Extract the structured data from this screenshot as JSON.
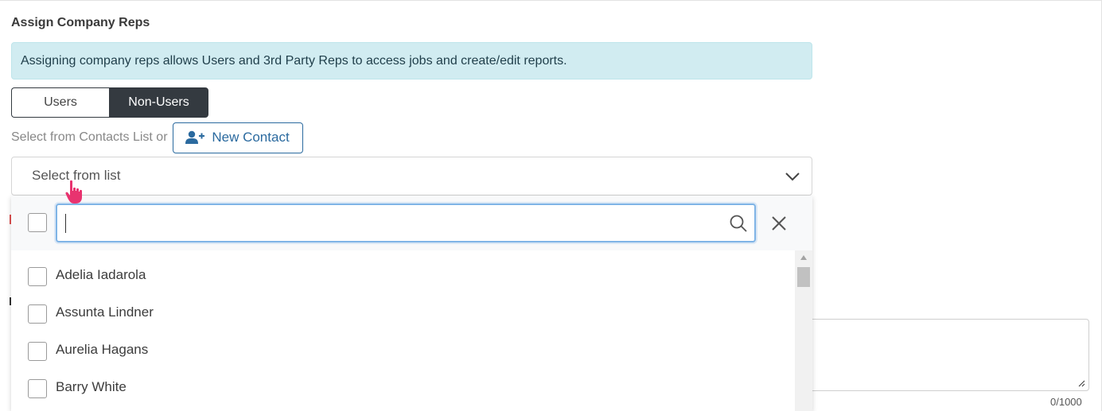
{
  "section": {
    "title": "Assign Company Reps"
  },
  "info_alert": {
    "text": "Assigning company reps allows Users and 3rd Party Reps to access jobs and create/edit reports."
  },
  "toggle": {
    "users_label": "Users",
    "non_users_label": "Non-Users",
    "active": "Non-Users"
  },
  "contacts": {
    "prompt": "Select from Contacts List or",
    "new_contact_label": "New Contact"
  },
  "select": {
    "placeholder": "Select from list"
  },
  "dropdown": {
    "search_value": "",
    "items": [
      {
        "label": "Adelia Iadarola",
        "checked": false
      },
      {
        "label": "Assunta Lindner",
        "checked": false
      },
      {
        "label": "Aurelia Hagans",
        "checked": false
      },
      {
        "label": "Barry White",
        "checked": false
      }
    ]
  },
  "notes": {
    "counter": "0/1000"
  },
  "colors": {
    "accent": "#2b6a9f",
    "info_bg": "#d1ecf1",
    "toggle_active": "#343a40",
    "focus_border": "#7fb4e6",
    "cursor": "#e8336f"
  }
}
